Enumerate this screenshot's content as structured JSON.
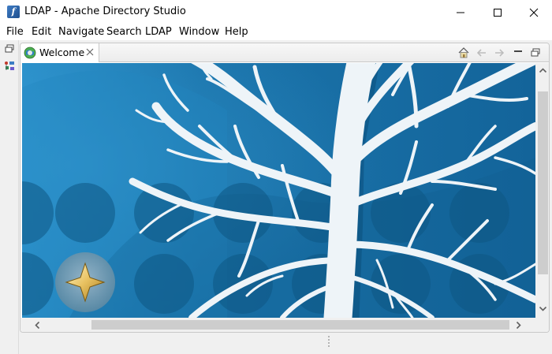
{
  "window": {
    "title": "LDAP - Apache Directory Studio",
    "app_icon_glyph": "f"
  },
  "menu": {
    "items": [
      "File",
      "Edit",
      "Navigate",
      "Search",
      "LDAP",
      "Window",
      "Help"
    ]
  },
  "editor": {
    "tabs": [
      {
        "label": "Welcome",
        "icon": "welcome-globe-icon",
        "active": true
      }
    ],
    "toolbar_icons": [
      "home-icon",
      "back-arrow-icon",
      "forward-arrow-icon",
      "minimize-view-icon",
      "restore-view-icon"
    ]
  },
  "welcome_page": {
    "background_color": "#1a6fa3",
    "illustration": "white-tree-on-blue",
    "launcher_icon": "star-sparkle-icon"
  },
  "colors": {
    "accent_blue": "#1a6fa3",
    "chrome_gray": "#f0f0f0"
  }
}
